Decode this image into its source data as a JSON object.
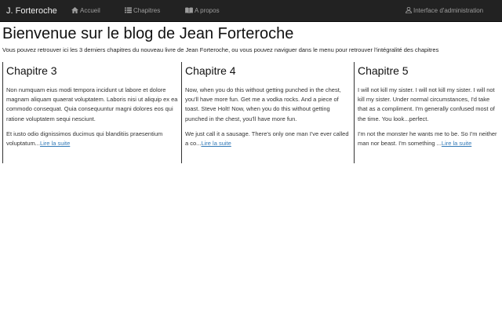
{
  "nav": {
    "brand": "J. Forteroche",
    "home": "Accueil",
    "chapters": "Chapitres",
    "about": "A propos",
    "admin": "Interface d'administration"
  },
  "icons": {
    "home": "home-icon",
    "chapters": "list-icon",
    "about": "book-icon",
    "admin": "user-icon"
  },
  "colors": {
    "navbar": "#222222",
    "nav_text": "#9d9d9d",
    "link": "#337ab7"
  },
  "main": {
    "title": "Bienvenue sur le blog de Jean Forteroche",
    "intro": "Vous pouvez retrouver ici les 3 derniers chapitres du nouveau livre de Jean Forteroche, ou vous pouvez naviguer dans le menu pour retrouver l'intégralité des chapitres",
    "read_more": "Lire la suite",
    "chapters": [
      {
        "title": "Chapitre 3",
        "p1": "Non numquam eius modi tempora incidunt ut labore et dolore magnam aliquam quaerat voluptatem. Laboris nisi ut aliquip ex ea commodo consequat. Quia consequuntur magni dolores eos qui ratione voluptatem sequi nesciunt.",
        "p2": "Et iusto odio dignissimos ducimus qui blanditiis praesentium voluptatum..."
      },
      {
        "title": "Chapitre 4",
        "p1": "Now, when you do this without getting punched in the chest, you'll have more fun. Get me a vodka rocks. And a piece of toast. Steve Holt! Now, when you do this without getting punched in the chest, you'll have more fun.",
        "p2": "We just call it a sausage. There's only one man I've ever called a co..."
      },
      {
        "title": "Chapitre 5",
        "p1": "I will not kill my sister. I will not kill my sister. I will not kill my sister. Under normal circumstances, I'd take that as a compliment. I'm generally confused most of the time. You look...perfect.",
        "p2": "I'm not the monster he wants me to be. So I'm neither man nor beast. I'm something ..."
      }
    ]
  }
}
